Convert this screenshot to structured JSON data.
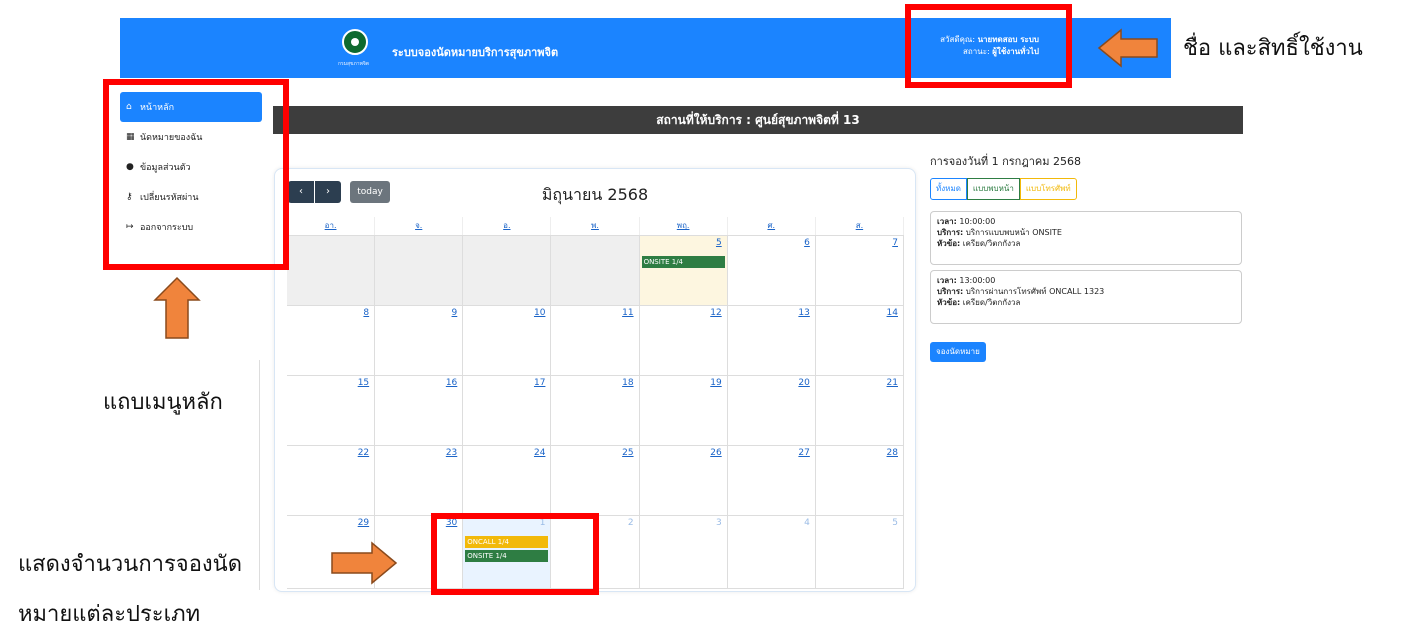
{
  "header": {
    "app_title": "ระบบจองนัดหมายบริการสุขภาพจิต",
    "logo_caption": "กรมสุขภาพจิต",
    "greeting_label": "สวัสดีคุณ:",
    "user_name": "นายทดสอบ ระบบ",
    "status_label": "สถานะ:",
    "user_role": "ผู้ใช้งานทั่วไป"
  },
  "sidebar": {
    "items": [
      {
        "label": "หน้าหลัก",
        "icon": "home-icon",
        "active": true
      },
      {
        "label": "นัดหมายของฉัน",
        "icon": "calendar-check-icon",
        "active": false
      },
      {
        "label": "ข้อมูลส่วนตัว",
        "icon": "user-icon",
        "active": false
      },
      {
        "label": "เปลี่ยนรหัสผ่าน",
        "icon": "key-icon",
        "active": false
      },
      {
        "label": "ออกจากระบบ",
        "icon": "logout-icon",
        "active": false
      }
    ]
  },
  "place_bar": "สถานที่ให้บริการ : ศูนย์สุขภาพจิตที่ 13",
  "calendar": {
    "prev": "‹",
    "next": "›",
    "today": "today",
    "title": "มิถุนายน 2568",
    "days_of_week": [
      "อา.",
      "จ.",
      "อ.",
      "พ.",
      "พฤ.",
      "ศ.",
      "ส."
    ],
    "weeks": [
      [
        "",
        "",
        "",
        "",
        "5",
        "6",
        "7"
      ],
      [
        "8",
        "9",
        "10",
        "11",
        "12",
        "13",
        "14"
      ],
      [
        "15",
        "16",
        "17",
        "18",
        "19",
        "20",
        "21"
      ],
      [
        "22",
        "23",
        "24",
        "25",
        "26",
        "27",
        "28"
      ],
      [
        "29",
        "30",
        "1",
        "2",
        "3",
        "4",
        "5"
      ]
    ],
    "event_week0_thu": "ONSITE 1/4",
    "event_week4_tue_oncall": "ONCALL 1/4",
    "event_week4_tue_onsite": "ONSITE 1/4"
  },
  "right_panel": {
    "title": "การจองวันที่ 1 กรกฎาคม 2568",
    "filters": {
      "all": "ทั้งหมด",
      "meet": "แบบพบหน้า",
      "phone": "แบบโทรศัพท์"
    },
    "appointments": [
      {
        "time_label": "เวลา:",
        "time": "10:00:00",
        "service_label": "บริการ:",
        "service": "บริการแบบพบหน้า ONSITE",
        "topic_label": "หัวข้อ:",
        "topic": "เครียด/วิตกกังวล"
      },
      {
        "time_label": "เวลา:",
        "time": "13:00:00",
        "service_label": "บริการ:",
        "service": "บริการผ่านการโทรศัพท์ ONCALL 1323",
        "topic_label": "หัวข้อ:",
        "topic": "เครียด/วิตกกังวล"
      }
    ],
    "book_button": "จองนัดหมาย"
  },
  "annotations": {
    "user_note": "ชื่อ และสิทธิ์ใช้งาน",
    "menu_note": "แถบเมนูหลัก",
    "count_note_line1": "แสดงจำนวนการจองนัด",
    "count_note_line2": "หมายแต่ละประเภท",
    "arrow_color": "#f0843c",
    "highlight_color": "#ff0000"
  }
}
